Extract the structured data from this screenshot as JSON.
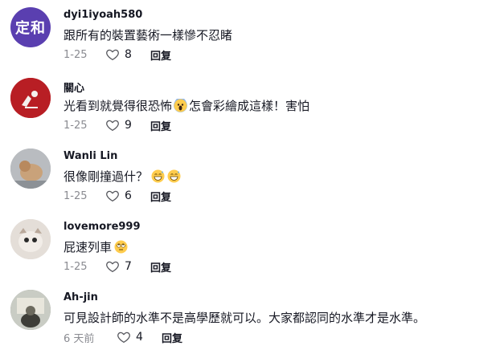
{
  "comments": [
    {
      "username": "dyi1iyoah580",
      "avatar_text": "定和",
      "avatar_color": "#5a3fb0",
      "text": "跟所有的裝置藝術一樣慘不忍睹",
      "date": "1-25",
      "likes": "8",
      "reply_label": "回复",
      "emojis": []
    },
    {
      "username": "關心",
      "avatar_text": "",
      "avatar_color": "#b81e24",
      "text": "光看到就覺得很恐怖",
      "text_after": "怎會彩繪成這樣！害怕",
      "date": "1-25",
      "likes": "9",
      "reply_label": "回复",
      "emojis": [
        "scream-emoji"
      ]
    },
    {
      "username": "Wanli Lin",
      "avatar_text": "",
      "avatar_color": "#9aa0a6",
      "text": "很像剛撞過什？",
      "date": "1-25",
      "likes": "6",
      "reply_label": "回复",
      "emojis": [
        "grin-sweat-emoji",
        "grin-sweat-emoji"
      ]
    },
    {
      "username": "lovemore999",
      "avatar_text": "",
      "avatar_color": "#d8d2cc",
      "text": "屁速列車",
      "date": "1-25",
      "likes": "7",
      "reply_label": "回复",
      "emojis": [
        "rolling-eyes-emoji"
      ]
    },
    {
      "username": "Ah-jin",
      "avatar_text": "",
      "avatar_color": "#8a8f84",
      "text": "可見設計師的水準不是高學歷就可以。大家都認同的水準才是水準。",
      "date": "6 天前",
      "likes": "4",
      "reply_label": "回复",
      "emojis": []
    }
  ]
}
